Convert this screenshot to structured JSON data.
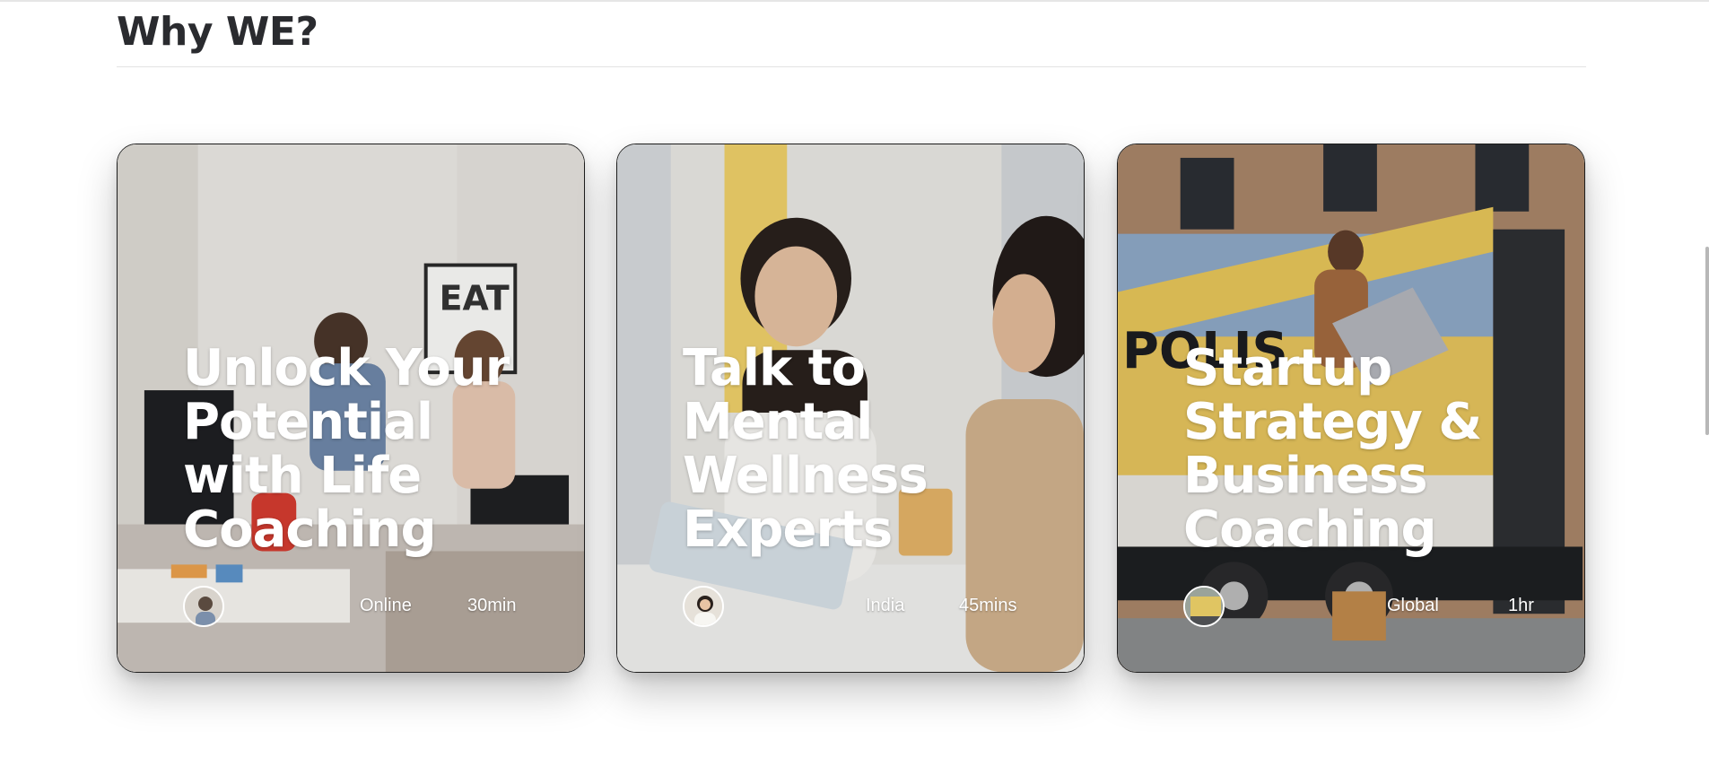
{
  "section": {
    "heading": "Why WE?"
  },
  "cards": [
    {
      "title": "Unlock Your Potential with Life Coaching",
      "location": "Online",
      "duration": "30min"
    },
    {
      "title": "Talk to Mental Wellness Experts",
      "location": "India",
      "duration": "45mins"
    },
    {
      "title": "Startup Strategy & Business Coaching",
      "location": "Global",
      "duration": "1hr"
    }
  ],
  "colors": {
    "heading": "#2a2b2f",
    "card_text": "#ffffff",
    "rule": "#e2e2e2"
  }
}
